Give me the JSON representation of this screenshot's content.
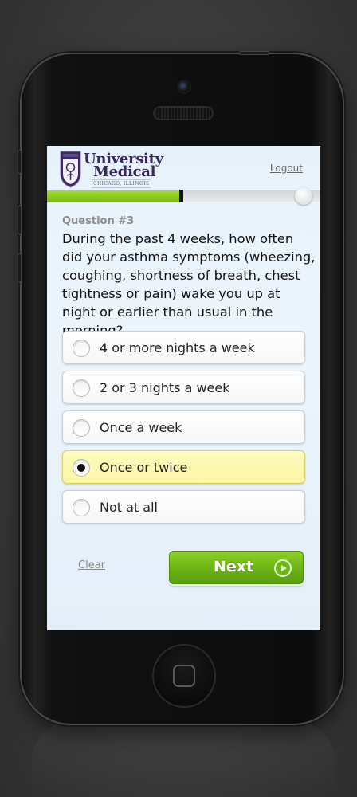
{
  "header": {
    "logo_line1": "University",
    "logo_line2": "Medical",
    "logo_sub": "CHICAGO, ILLINOIS",
    "logout_label": "Logout"
  },
  "progress": {
    "fraction": 0.49
  },
  "question": {
    "label": "Question #3",
    "text": "During the past 4 weeks, how often did your asthma symptoms (wheezing, coughing, shortness of breath, chest tightness or pain) wake you up at night or earlier than usual in the morning?"
  },
  "options": [
    {
      "label": "4 or more nights a week",
      "selected": false
    },
    {
      "label": "2 or 3 nights a week",
      "selected": false
    },
    {
      "label": "Once a week",
      "selected": false
    },
    {
      "label": "Once or twice",
      "selected": true
    },
    {
      "label": "Not at all",
      "selected": false
    }
  ],
  "actions": {
    "clear_label": "Clear",
    "next_label": "Next"
  },
  "colors": {
    "brand_purple": "#3a2a5c",
    "progress_green": "#8fcd20",
    "next_green": "#6cb516",
    "selected_yellow": "#fbf5a3"
  },
  "icons": {
    "logo": "university-medical-shield-icon",
    "next": "play-circle-icon",
    "radio": "radio-icon",
    "home": "home-button-icon"
  }
}
